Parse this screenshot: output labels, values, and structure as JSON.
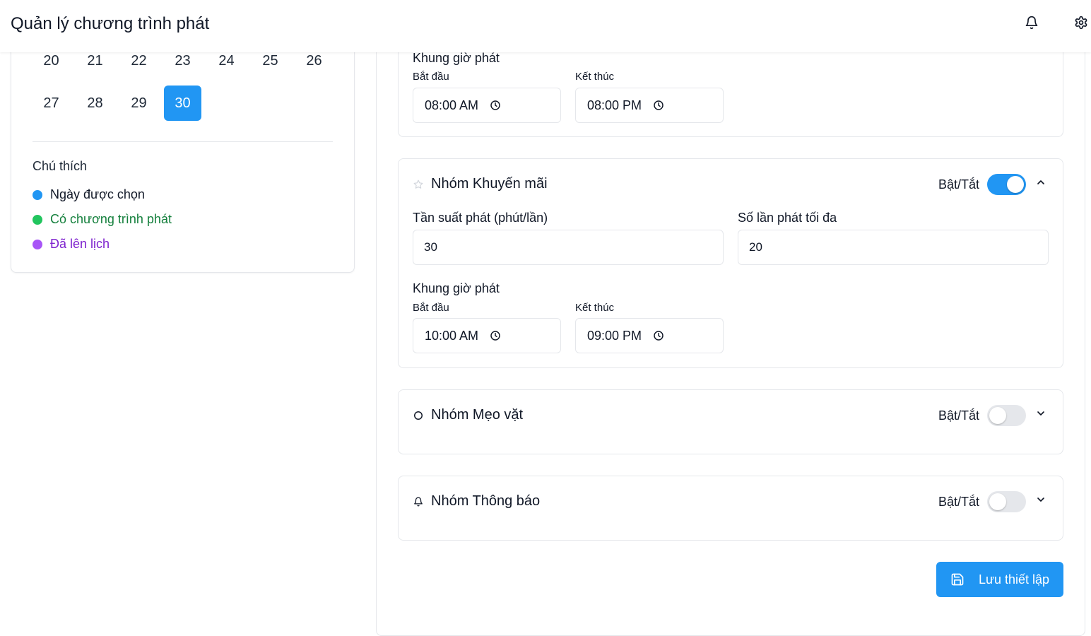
{
  "header": {
    "title": "Quản lý chương trình phát",
    "bell_icon": "bell-icon",
    "settings_icon": "gear-icon"
  },
  "calendar": {
    "rows": [
      [
        "20",
        "21",
        "22",
        "23",
        "24",
        "25",
        "26"
      ],
      [
        "27",
        "28",
        "29",
        "30"
      ]
    ],
    "selected_day": "30",
    "selected_color": "#2196f3"
  },
  "legend": {
    "title": "Chú thích",
    "items": [
      {
        "label": "Ngày được chọn",
        "color": "#2196f3",
        "text_color": "#111827"
      },
      {
        "label": "Có chương trình phát",
        "color": "#22c55e",
        "text_color": "#15803d"
      },
      {
        "label": "Đã lên lịch",
        "color": "#a855f7",
        "text_color": "#7e22ce"
      }
    ]
  },
  "groups": {
    "partial": {
      "time_window_label": "Khung giờ phát",
      "start_label": "Bắt đầu",
      "end_label": "Kết thúc",
      "start_value": "08:00 AM",
      "end_value": "08:00 PM"
    },
    "promo": {
      "title": "Nhóm Khuyến mãi",
      "icon": "star-icon",
      "toggle_label": "Bật/Tắt",
      "enabled": true,
      "expanded": true,
      "frequency_label": "Tần suất phát (phút/lần)",
      "frequency_value": "30",
      "max_label": "Số lần phát tối đa",
      "max_value": "20",
      "time_window_label": "Khung giờ phát",
      "start_label": "Bắt đầu",
      "end_label": "Kết thúc",
      "start_value": "10:00 AM",
      "end_value": "09:00 PM"
    },
    "tips": {
      "title": "Nhóm Mẹo vặt",
      "icon": "circle-icon",
      "toggle_label": "Bật/Tắt",
      "enabled": false,
      "expanded": false
    },
    "notify": {
      "title": "Nhóm Thông báo",
      "icon": "bell-icon",
      "toggle_label": "Bật/Tắt",
      "enabled": false,
      "expanded": false
    }
  },
  "save_button": {
    "label": "Lưu thiết lập",
    "icon": "save-icon"
  },
  "colors": {
    "accent": "#2196f3",
    "border": "#e5e7eb"
  }
}
